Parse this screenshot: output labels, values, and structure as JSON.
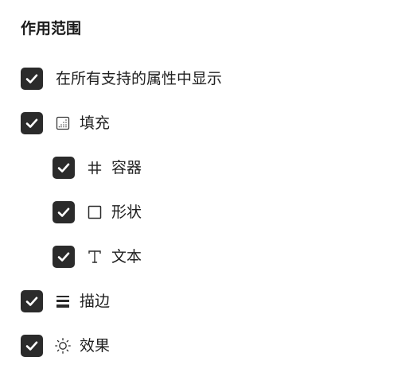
{
  "section": {
    "title": "作用范围"
  },
  "options": [
    {
      "id": "all",
      "label": "在所有支持的属性中显示",
      "checked": true,
      "icon": null
    },
    {
      "id": "fill",
      "label": "填充",
      "checked": true,
      "icon": "fill-icon"
    },
    {
      "id": "container",
      "label": "容器",
      "checked": true,
      "icon": "frame-icon"
    },
    {
      "id": "shape",
      "label": "形状",
      "checked": true,
      "icon": "shape-square-icon"
    },
    {
      "id": "text",
      "label": "文本",
      "checked": true,
      "icon": "text-icon"
    },
    {
      "id": "stroke",
      "label": "描边",
      "checked": true,
      "icon": "stroke-icon"
    },
    {
      "id": "effect",
      "label": "效果",
      "checked": true,
      "icon": "effect-sun-icon"
    }
  ],
  "colors": {
    "checkbox_bg": "#2b2b2b",
    "checkmark": "#ffffff",
    "text": "#1f1f1f",
    "icon": "#2a2a2a"
  }
}
